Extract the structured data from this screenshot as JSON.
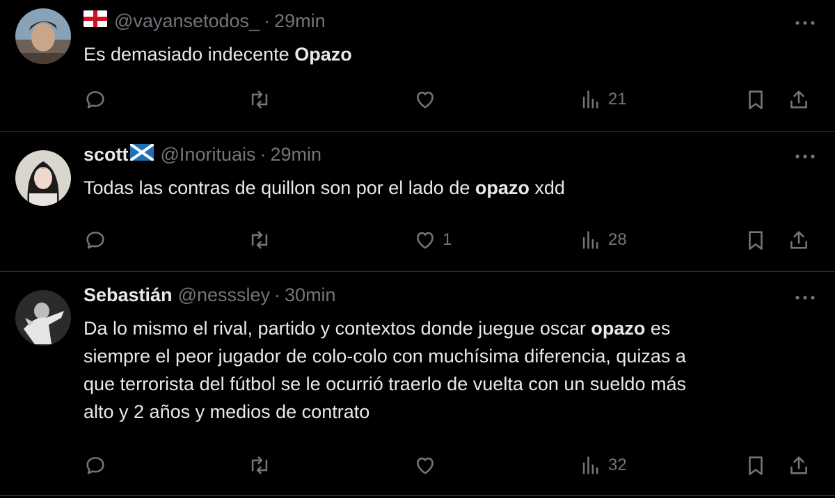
{
  "tweets": [
    {
      "handle": "@vayansetodos_",
      "time": "29min",
      "text_before": "Es demasiado indecente ",
      "text_bold": "Opazo",
      "text_after": "",
      "replies": "",
      "retweets": "",
      "likes": "",
      "views": "21"
    },
    {
      "name": "scott",
      "handle": "@Inorituais",
      "time": "29min",
      "text_before": "Todas las contras de quillon son por el lado de ",
      "text_bold": "opazo",
      "text_after": " xdd",
      "replies": "",
      "retweets": "",
      "likes": "1",
      "views": "28"
    },
    {
      "name": "Sebastián",
      "handle": "@nesssley",
      "time": "30min",
      "text_line1_before": "Da lo mismo el rival, partido y contextos donde juegue oscar ",
      "text_bold": "opazo",
      "text_line1_after": " es",
      "text_line2": "siempre el peor jugador de colo-colo con muchísima diferencia, quizas a",
      "text_line3": "que terrorista del fútbol se le ocurrió traerlo de vuelta con un sueldo más",
      "text_line4": "alto y 2 años y medios de contrato",
      "replies": "",
      "retweets": "",
      "likes": "",
      "views": "32"
    }
  ],
  "separator": "·",
  "icons": {
    "reply": "reply-icon",
    "retweet": "retweet-icon",
    "like": "heart-icon",
    "views": "views-icon",
    "bookmark": "bookmark-icon",
    "share": "share-icon",
    "more": "more-icon"
  },
  "colors": {
    "background": "#000000",
    "text": "#e7e9ea",
    "muted": "#71767b",
    "divider": "#2f3336"
  }
}
